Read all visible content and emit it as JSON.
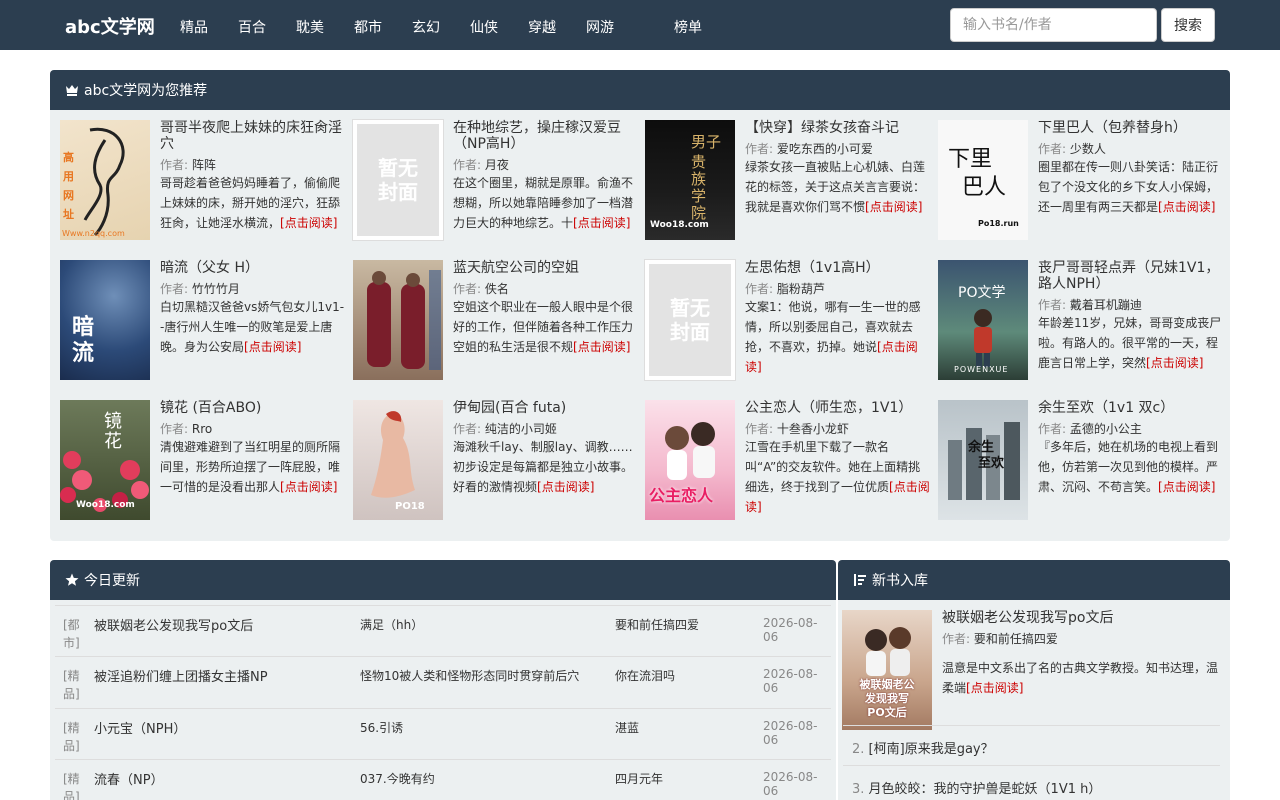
{
  "nav": {
    "brand": "abc文学网",
    "items": [
      "精品",
      "百合",
      "耽美",
      "都市",
      "玄幻",
      "仙侠",
      "穿越",
      "网游",
      "榜单"
    ],
    "search_placeholder": "输入书名/作者",
    "search_button": "搜索"
  },
  "recommend": {
    "title": "abc文学网为您推荐",
    "author_label": "作者:",
    "read_more": "[点击阅读]",
    "items": [
      {
        "title": "哥哥半夜爬上妹妹的床狂肏淫穴",
        "author": "阵阵",
        "desc": "哥哥趁着爸爸妈妈睡着了，偷偷爬上妹妹的床，掰开她的淫穴，狂舔狂肏，让她淫水横流，",
        "cover": "site-watermark",
        "cover_lines": [
          "高",
          "用",
          "网",
          "址"
        ],
        "cover_url": "Www.n2qq.com"
      },
      {
        "title": "在种地综艺，操庄稼汉爱豆（NP高H）",
        "author": "月夜",
        "desc": "在这个圈里，糊就是原罪。俞渔不想糊，所以她靠陪睡参加了一档潜力巨大的种地综艺。十",
        "cover": "no-cover",
        "cover_text": [
          "暂无",
          "封面"
        ]
      },
      {
        "title": "【快穿】绿茶女孩奋斗记",
        "author": "爱吃东西的小可爱",
        "desc": "绿茶女孩一直被贴上心机婊、白莲花的标签，关于这点关言言要说：我就是喜欢你们骂不惯",
        "cover": "dark-art",
        "cover_text": [
          "男子",
          "贵族学院"
        ],
        "cover_url": "Woo18.com"
      },
      {
        "title": "下里巴人（包养替身h）",
        "author": "少数人",
        "desc": "圈里都在传一则八卦笑话：陆正衍包了个没文化的乡下女人小保姆，还一周里有两三天都是",
        "cover": "ink-text",
        "cover_text": [
          "下里",
          "巴人"
        ],
        "cover_url": "Po18.run"
      },
      {
        "title": "暗流（父女 H）",
        "author": "竹竹竹月",
        "desc": "白切黑糙汉爸爸vs娇气包女儿1v1--唐行州人生唯一的败笔是爱上唐晚。身为公安局",
        "cover": "dark-blue",
        "cover_text": [
          "暗",
          "流"
        ]
      },
      {
        "title": "蓝天航空公司的空姐",
        "author": "佚名",
        "desc": "空姐这个职业在一般人眼中是个很好的工作，但伴随着各种工作压力空姐的私生活是很不规",
        "cover": "photo-uniform"
      },
      {
        "title": "左思佑想（1v1高H）",
        "author": "脂粉葫芦",
        "desc": "文案1：他说，哪有一生一世的感情，所以别委屈自己，喜欢就去抢，不喜欢，扔掉。她说",
        "cover": "no-cover",
        "cover_text": [
          "暂无",
          "封面"
        ]
      },
      {
        "title": "丧尸哥哥轻点弄（兄妹1V1，路人NPH）",
        "author": "戴着耳机蹦迪",
        "desc": "年龄差11岁，兄妹，哥哥变成丧尸啦。有路人的。很平常的一天，程鹿言日常上学，突然",
        "cover": "anime-green",
        "cover_text": [
          "PO文学"
        ],
        "cover_url": "POWENXUE"
      },
      {
        "title": "镜花 (百合ABO)",
        "author": "Rro",
        "desc": "清傀避难避到了当红明星的厕所隔间里，形势所迫摆了一阵屁股，唯一可惜的是没看出那人",
        "cover": "flowers",
        "cover_text": [
          "镜",
          "花"
        ],
        "cover_url": "Woo18.com"
      },
      {
        "title": "伊甸园(百合 futa)",
        "author": "纯洁的小司姬",
        "desc": "海滩秋千lay、制服lay、调教……初步设定是每篇都是独立小故事。好看的激情视频",
        "cover": "photo-figure",
        "cover_url": "PO18"
      },
      {
        "title": "公主恋人（师生恋，1V1）",
        "author": "十叁香小龙虾",
        "desc": "江雪在手机里下载了一款名叫“A”的交友软件。她在上面精挑细选，终于找到了一位优质",
        "cover": "pink-couple",
        "cover_text": [
          "公主恋人"
        ]
      },
      {
        "title": "余生至欢（1v1 双c）",
        "author": "孟德的小公主",
        "desc": "『多年后，她在机场的电视上看到他，仿若第一次见到他的模样。严肃、沉闷、不苟言笑。",
        "cover": "city-gray",
        "cover_text": [
          "余生",
          "至欢"
        ]
      }
    ]
  },
  "today": {
    "title": "今日更新",
    "rows": [
      {
        "cat": "[都市]",
        "name": "被联姻老公发现我写po文后",
        "chapter": "满足（hh）",
        "author": "要和前任搞四爱",
        "date": "2026-08-06"
      },
      {
        "cat": "[精品]",
        "name": "被淫追粉们缠上团播女主播NP",
        "chapter": "怪物10被人类和怪物形态同时贯穿前后穴",
        "author": "你在流泪吗",
        "date": "2026-08-06"
      },
      {
        "cat": "[精品]",
        "name": "小元宝（NPH）",
        "chapter": "56.引诱",
        "author": "湛蓝",
        "date": "2026-08-06"
      },
      {
        "cat": "[精品]",
        "name": "流春（NP）",
        "chapter": "037.今晚有约",
        "author": "四月元年",
        "date": "2026-08-06"
      }
    ]
  },
  "newbooks": {
    "title": "新书入库",
    "featured": {
      "title": "被联姻老公发现我写po文后",
      "author": "要和前任搞四爱",
      "desc": "温意是中文系出了名的古典文学教授。知书达理，温柔端",
      "cover_text": [
        "被联姻老公",
        "发现我写",
        "PO文后"
      ]
    },
    "list": [
      {
        "rank": "2.",
        "title": "[柯南]原来我是gay？"
      },
      {
        "rank": "3.",
        "title": "月色皎皎：我的守护兽是蛇妖（1V1 h）"
      }
    ]
  }
}
